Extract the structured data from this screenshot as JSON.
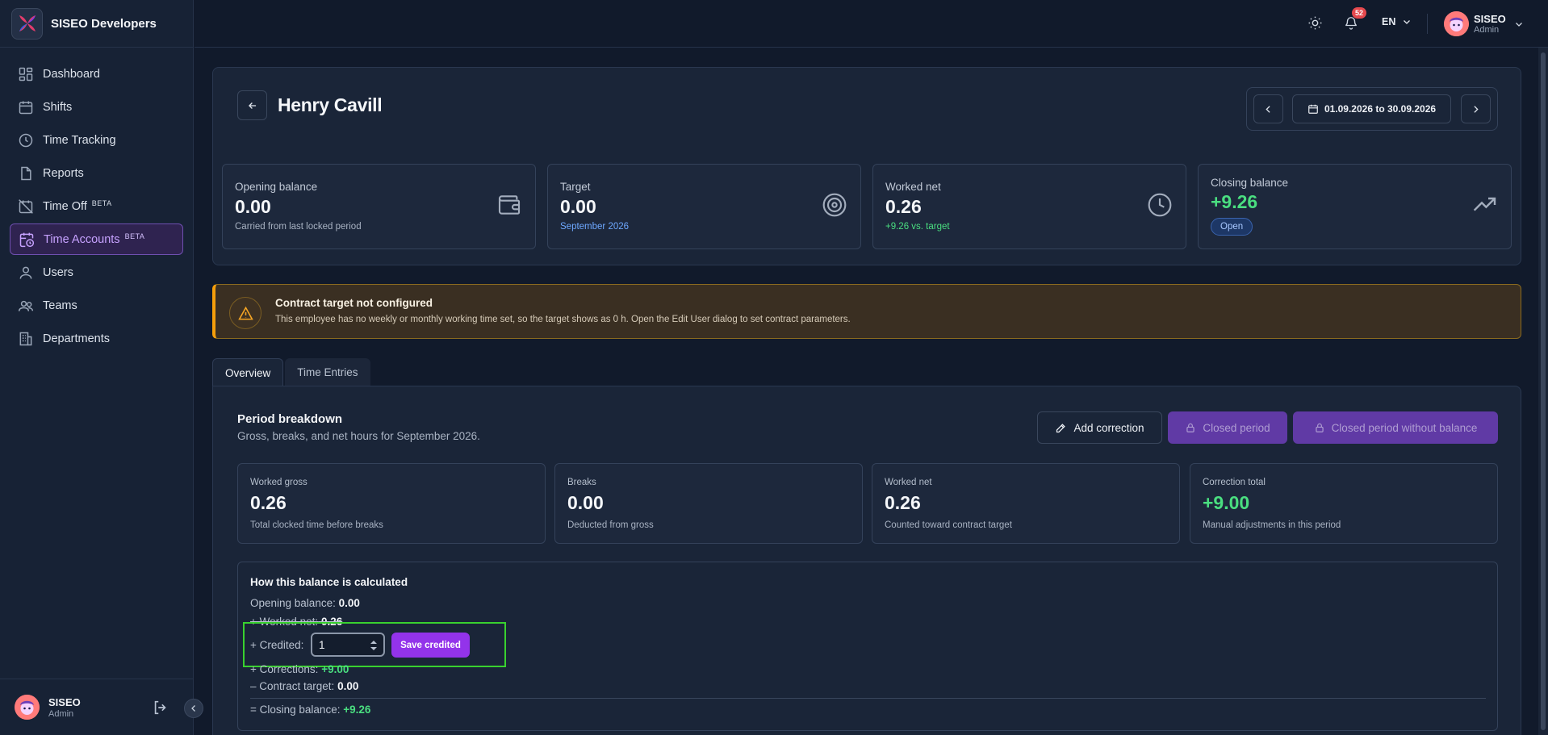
{
  "brand": {
    "name": "SISEO Developers"
  },
  "sidebar": {
    "items": [
      {
        "label": "Dashboard",
        "icon": "dashboard-icon",
        "active": false,
        "beta": ""
      },
      {
        "label": "Shifts",
        "icon": "calendar-icon",
        "active": false,
        "beta": ""
      },
      {
        "label": "Time Tracking",
        "icon": "clock-icon",
        "active": false,
        "beta": ""
      },
      {
        "label": "Reports",
        "icon": "file-icon",
        "active": false,
        "beta": ""
      },
      {
        "label": "Time Off",
        "icon": "calendar-off-icon",
        "active": false,
        "beta": "BETA"
      },
      {
        "label": "Time Accounts",
        "icon": "calendar-clock-icon",
        "active": true,
        "beta": "BETA"
      },
      {
        "label": "Users",
        "icon": "user-icon",
        "active": false,
        "beta": ""
      },
      {
        "label": "Teams",
        "icon": "users-icon",
        "active": false,
        "beta": ""
      },
      {
        "label": "Departments",
        "icon": "building-icon",
        "active": false,
        "beta": ""
      }
    ],
    "footer": {
      "name": "SISEO",
      "role": "Admin"
    }
  },
  "topbar": {
    "notifications_count": "52",
    "language": "EN",
    "user": {
      "name": "SISEO",
      "role": "Admin"
    }
  },
  "header": {
    "title": "Henry Cavill",
    "period": "01.09.2026 to 30.09.2026"
  },
  "stats": [
    {
      "label": "Opening balance",
      "value": "0.00",
      "sub": "Carried from last locked period",
      "icon": "wallet-icon"
    },
    {
      "label": "Target",
      "value": "0.00",
      "sub": "September 2026",
      "icon": "target-icon"
    },
    {
      "label": "Worked net",
      "value": "0.26",
      "sub": "+9.26 vs. target",
      "icon": "clock-icon"
    },
    {
      "label": "Closing balance",
      "value": "+9.26",
      "badge": "Open",
      "icon": "trending-up-icon"
    }
  ],
  "warning": {
    "title": "Contract target not configured",
    "text": "This employee has no weekly or monthly working time set, so the target shows as 0 h. Open the Edit User dialog to set contract parameters."
  },
  "tabs": [
    {
      "label": "Overview",
      "active": true
    },
    {
      "label": "Time Entries",
      "active": false
    }
  ],
  "breakdown": {
    "title": "Period breakdown",
    "subtitle": "Gross, breaks, and net hours for September 2026.",
    "buttons": {
      "add_correction": "Add correction",
      "closed_period": "Closed period",
      "closed_without_balance": "Closed period without balance"
    },
    "cards": [
      {
        "label": "Worked gross",
        "value": "0.26",
        "sub": "Total clocked time before breaks"
      },
      {
        "label": "Breaks",
        "value": "0.00",
        "sub": "Deducted from gross"
      },
      {
        "label": "Worked net",
        "value": "0.26",
        "sub": "Counted toward contract target"
      },
      {
        "label": "Correction total",
        "value": "+9.00",
        "sub": "Manual adjustments in this period"
      }
    ]
  },
  "calc": {
    "title": "How this balance is calculated",
    "opening_label": "Opening balance:",
    "opening_value": "0.00",
    "worked_label": "+ Worked net:",
    "worked_value": "0.26",
    "credited_label": "+ Credited:",
    "credited_value": "1",
    "save_label": "Save credited",
    "corrections_label": "+ Corrections:",
    "corrections_value": "+9.00",
    "target_label": "– Contract target:",
    "target_value": "0.00",
    "closing_label": "= Closing balance:",
    "closing_value": "+9.26"
  }
}
